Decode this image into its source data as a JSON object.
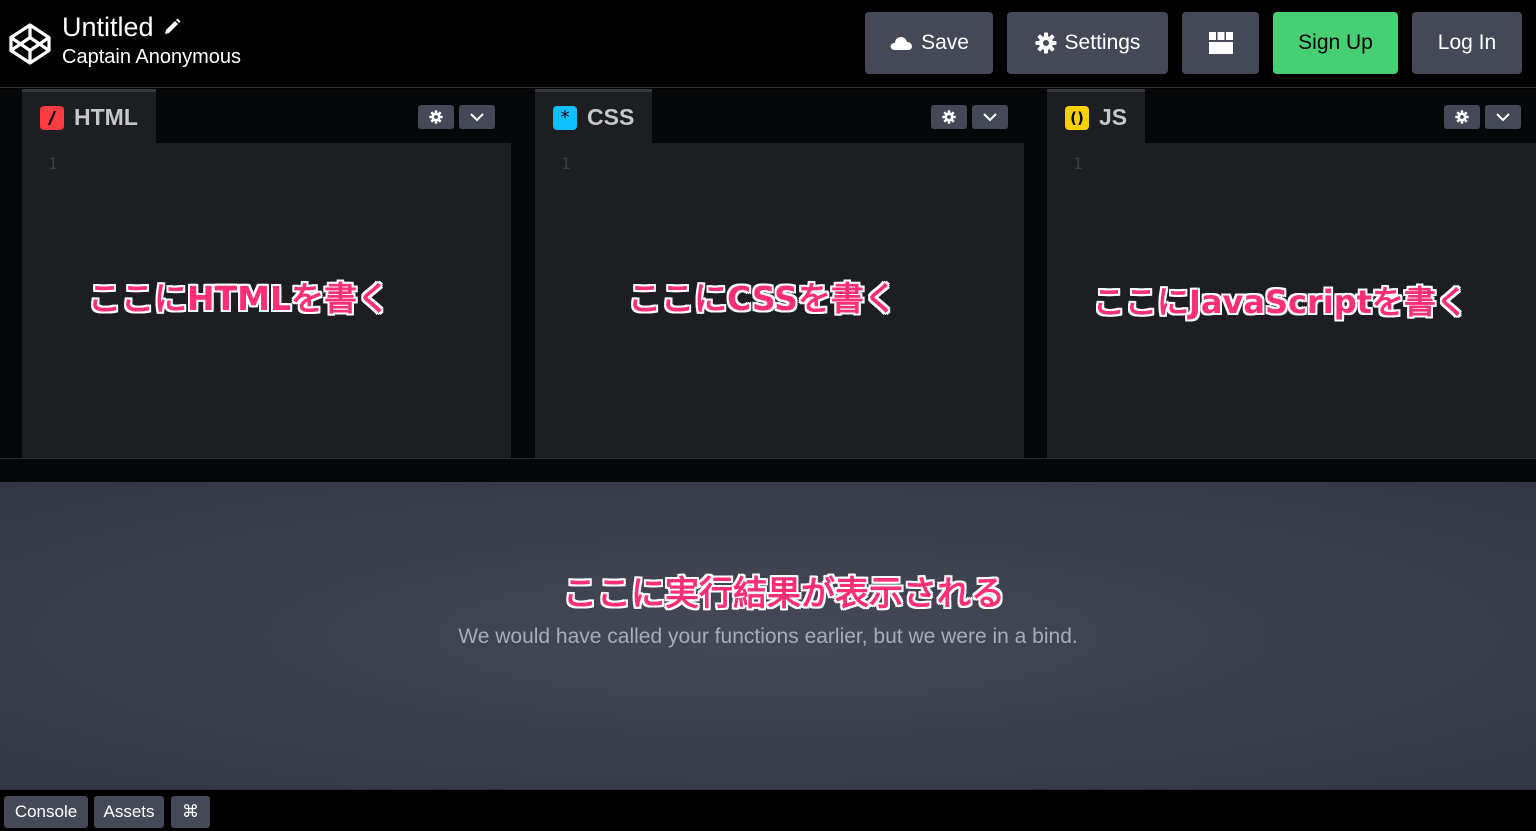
{
  "header": {
    "title": "Untitled",
    "author": "Captain Anonymous",
    "buttons": {
      "save": "Save",
      "settings": "Settings",
      "signup": "Sign Up",
      "login": "Log In"
    }
  },
  "editors": [
    {
      "label": "HTML",
      "icon": "html-slash-icon",
      "line": "1",
      "annotation": "ここにHTMLを書く"
    },
    {
      "label": "CSS",
      "icon": "css-asterisk-icon",
      "line": "1",
      "annotation": "ここにCSSを書く"
    },
    {
      "label": "JS",
      "icon": "js-parens-icon",
      "line": "1",
      "annotation": "ここにJavaScriptを書く"
    }
  ],
  "result": {
    "annotation": "ここに実行結果が表示される",
    "message": "We would have called your functions earlier, but we were in a bind."
  },
  "footer": {
    "console": "Console",
    "assets": "Assets",
    "shortcuts": "⌘"
  },
  "colors": {
    "accent_green": "#47cf73",
    "html": "#ff3c41",
    "css": "#0ebeff",
    "js": "#fcd000",
    "annotation": "#ff2f76"
  }
}
